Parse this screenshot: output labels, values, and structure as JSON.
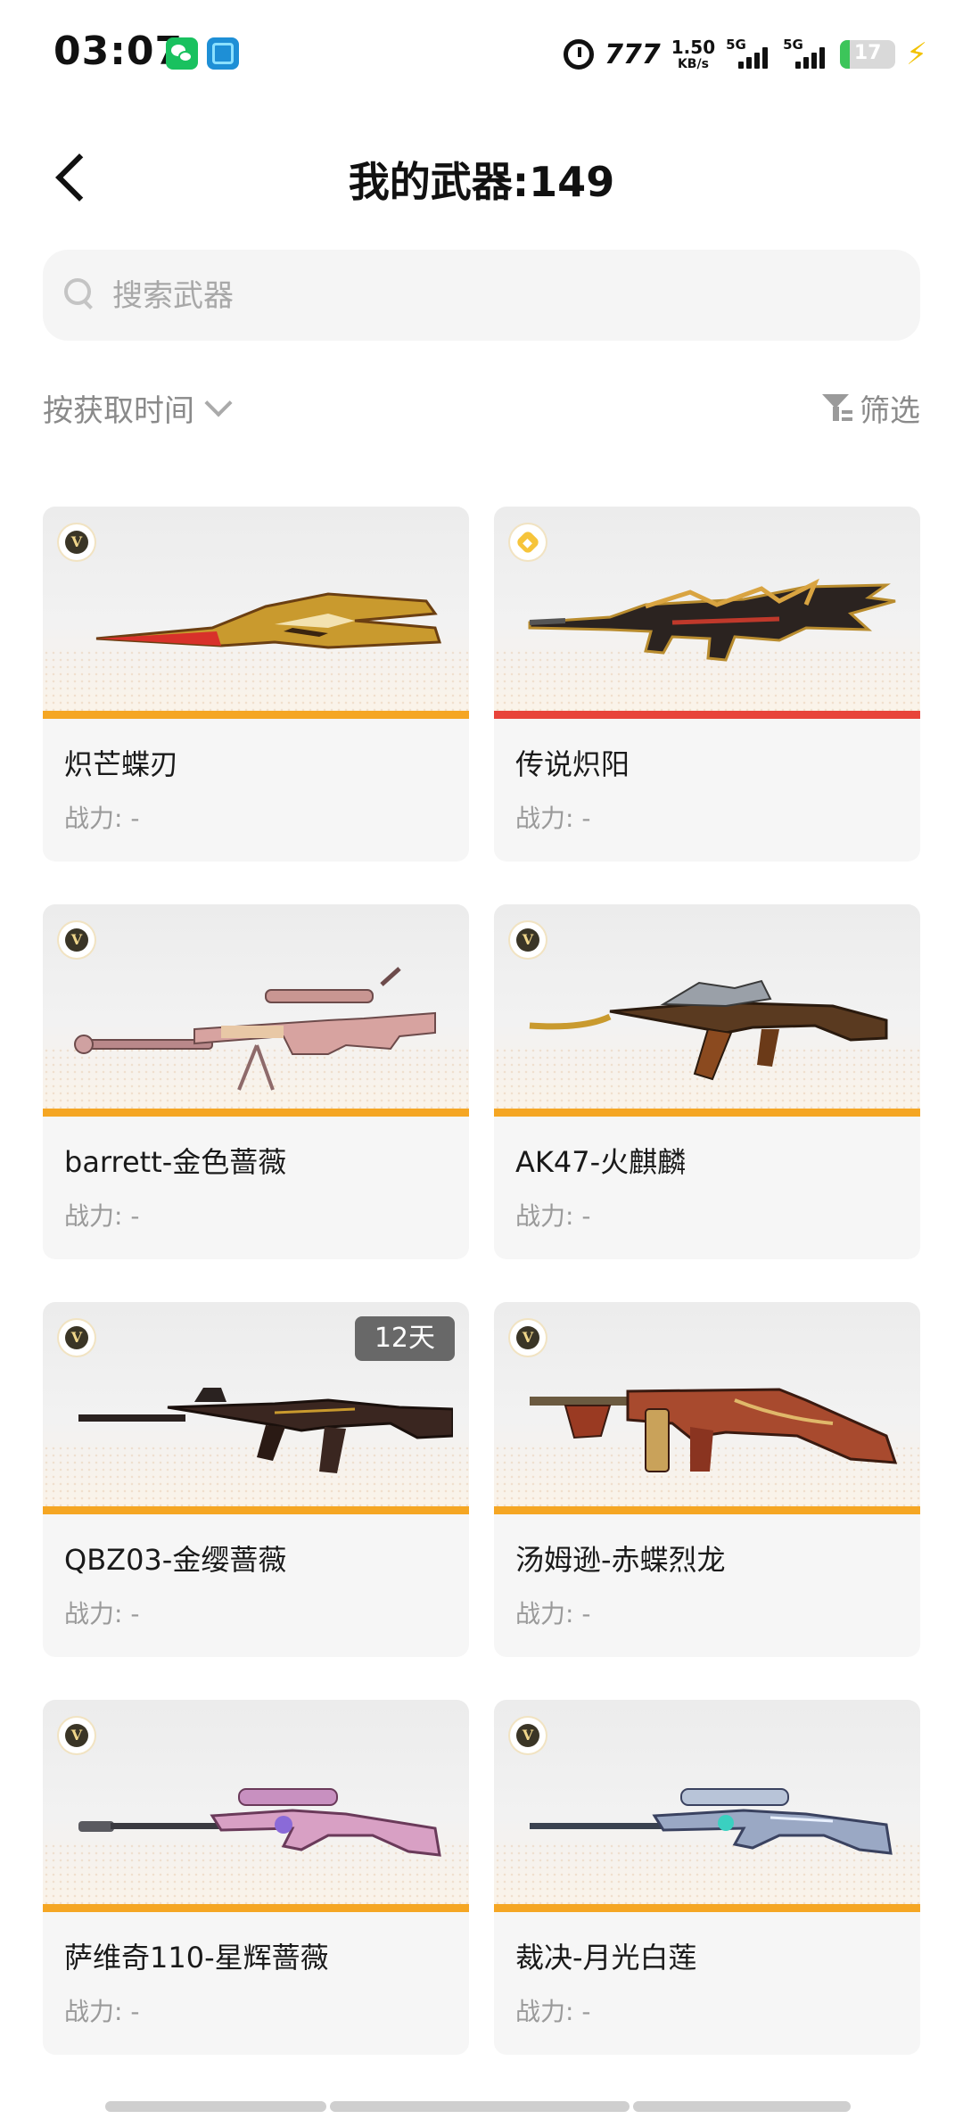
{
  "status_bar": {
    "time": "03:07",
    "nfc": "777",
    "net_speed_value": "1.50",
    "net_speed_unit": "KB/s",
    "signal_1": "5G",
    "signal_2": "5G",
    "battery": "17",
    "battery_level": 0.17,
    "icons": [
      "wechat-icon",
      "life-app-icon",
      "alarm-icon",
      "nfc-icon",
      "signal-icon",
      "battery-icon",
      "charging-bolt-icon"
    ]
  },
  "header": {
    "title": "我的武器:149",
    "back_icon": "chevron-left-icon"
  },
  "search": {
    "placeholder": "搜索武器",
    "value": ""
  },
  "toolbar": {
    "sort_label": "按获取时间",
    "filter_label": "筛选"
  },
  "colors": {
    "accent_orange": "#f5a623",
    "legend_red": "#e8443a"
  },
  "weapons": [
    {
      "name": "炽芒蝶刃",
      "power": "战力: -",
      "badge": "V",
      "rarity": "gold"
    },
    {
      "name": "传说炽阳",
      "power": "战力: -",
      "badge": "legend",
      "rarity": "red"
    },
    {
      "name": "barrett-金色蔷薇",
      "power": "战力: -",
      "badge": "V",
      "rarity": "gold"
    },
    {
      "name": "AK47-火麒麟",
      "power": "战力: -",
      "badge": "V",
      "rarity": "gold"
    },
    {
      "name": "QBZ03-金缨蔷薇",
      "power": "战力: -",
      "badge": "V",
      "rarity": "gold",
      "days": "12天"
    },
    {
      "name": "汤姆逊-赤蝶烈龙",
      "power": "战力: -",
      "badge": "V",
      "rarity": "gold"
    },
    {
      "name": "萨维奇110-星辉蔷薇",
      "power": "战力: -",
      "badge": "V",
      "rarity": "gold"
    },
    {
      "name": "裁决-月光白莲",
      "power": "战力: -",
      "badge": "V",
      "rarity": "gold"
    }
  ]
}
